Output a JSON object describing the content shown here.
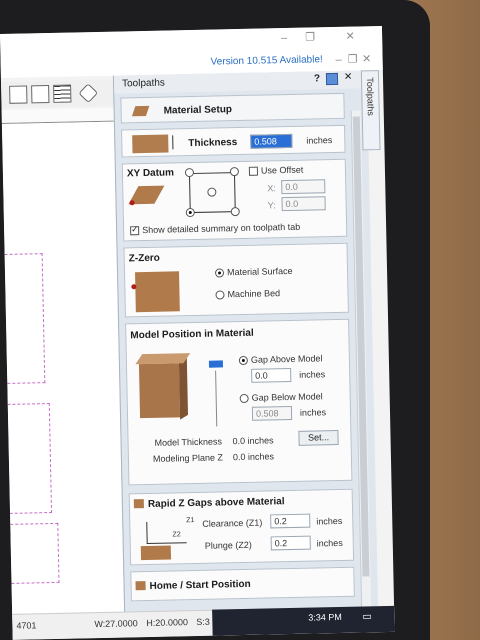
{
  "window": {
    "version_notice": "Version 10.515 Available!"
  },
  "panel": {
    "title": "Toolpaths",
    "side_tab": "Toolpaths"
  },
  "material_setup": {
    "title": "Material Setup"
  },
  "thickness": {
    "label": "Thickness",
    "value": "0.508",
    "unit": "inches"
  },
  "xy_datum": {
    "title": "XY Datum",
    "use_offset": "Use Offset",
    "x_label": "X:",
    "x_value": "0.0",
    "y_label": "Y:",
    "y_value": "0.0",
    "show_summary": "Show detailed summary on toolpath tab"
  },
  "z_zero": {
    "title": "Z-Zero",
    "material_surface": "Material Surface",
    "machine_bed": "Machine Bed"
  },
  "model_position": {
    "title": "Model Position in Material",
    "gap_above": "Gap Above Model",
    "gap_above_value": "0.0",
    "gap_above_unit": "inches",
    "gap_below": "Gap Below Model",
    "gap_below_value": "0.508",
    "gap_below_unit": "inches",
    "model_thickness_label": "Model Thickness",
    "model_thickness_value": "0.0 inches",
    "modeling_plane_label": "Modeling Plane Z",
    "modeling_plane_value": "0.0 inches",
    "set_button": "Set..."
  },
  "rapid_z": {
    "title": "Rapid Z Gaps above Material",
    "z1_mark": "Z1",
    "z2_mark": "Z2",
    "clearance_label": "Clearance (Z1)",
    "clearance_value": "0.2",
    "clearance_unit": "inches",
    "plunge_label": "Plunge (Z2)",
    "plunge_value": "0.2",
    "plunge_unit": "inches"
  },
  "home_position": {
    "title": "Home / Start Position"
  },
  "status": {
    "coord": "4701",
    "width": "W:27.0000",
    "height": "H:20.0000",
    "scale": "S:3"
  },
  "taskbar": {
    "time": "3:34 PM"
  },
  "colors": {
    "accent": "#2a6fd6",
    "material": "#b07a4a",
    "version_link": "#2a6fc0"
  }
}
